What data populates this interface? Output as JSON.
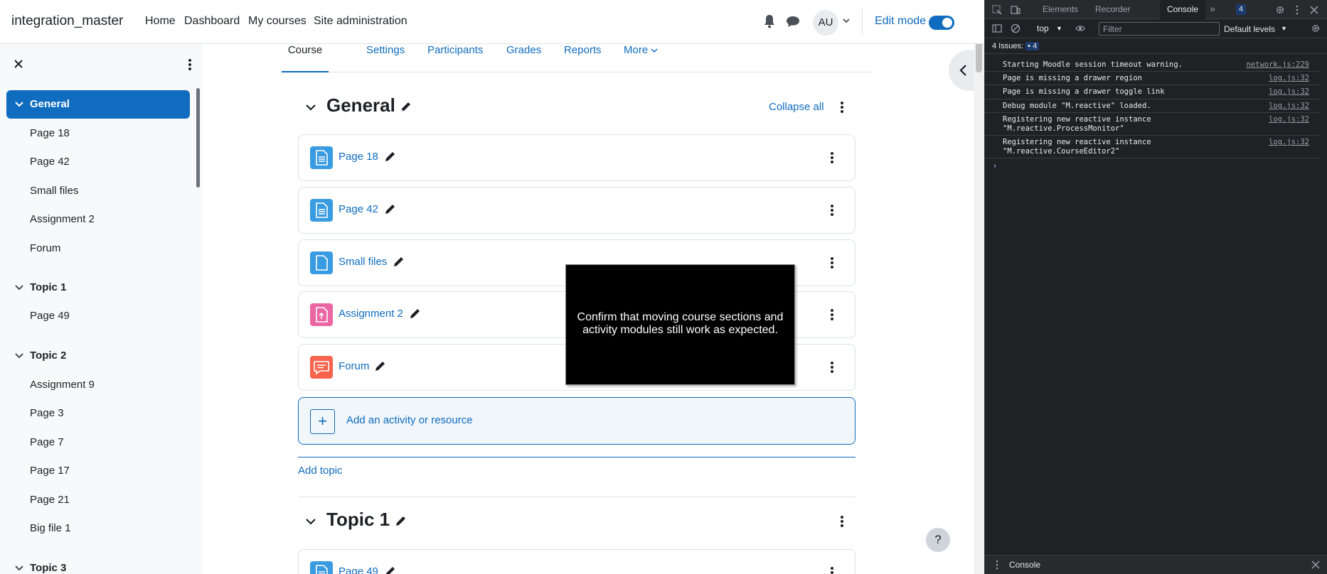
{
  "navbar": {
    "site_name": "integration_master",
    "links": [
      "Home",
      "Dashboard",
      "My courses",
      "Site administration"
    ],
    "avatar_initials": "AU",
    "edit_mode_label": "Edit mode",
    "edit_mode_on": true
  },
  "course_index": {
    "items": [
      {
        "label": "General",
        "type": "section",
        "active": true
      },
      {
        "label": "Page 18",
        "type": "activity"
      },
      {
        "label": "Page 42",
        "type": "activity"
      },
      {
        "label": "Small files",
        "type": "activity"
      },
      {
        "label": "Assignment 2",
        "type": "activity"
      },
      {
        "label": "Forum",
        "type": "activity"
      },
      {
        "label": "Topic 1",
        "type": "section"
      },
      {
        "label": "Page 49",
        "type": "activity"
      },
      {
        "label": "Topic 2",
        "type": "section"
      },
      {
        "label": "Assignment 9",
        "type": "activity"
      },
      {
        "label": "Page 3",
        "type": "activity"
      },
      {
        "label": "Page 7",
        "type": "activity"
      },
      {
        "label": "Page 17",
        "type": "activity"
      },
      {
        "label": "Page 21",
        "type": "activity"
      },
      {
        "label": "Big file 1",
        "type": "activity"
      },
      {
        "label": "Topic 3",
        "type": "section"
      }
    ]
  },
  "course_tabs": [
    "Course",
    "Settings",
    "Participants",
    "Grades",
    "Reports",
    "More"
  ],
  "sections": [
    {
      "title": "General",
      "collapse_all_label": "Collapse all",
      "activities": [
        {
          "name": "Page 18",
          "icon": "page-icon"
        },
        {
          "name": "Page 42",
          "icon": "page-icon"
        },
        {
          "name": "Small files",
          "icon": "file-icon"
        },
        {
          "name": "Assignment 2",
          "icon": "assignment-icon"
        },
        {
          "name": "Forum",
          "icon": "forum-icon"
        }
      ],
      "add_activity_label": "Add an activity or resource",
      "add_topic_label": "Add topic"
    },
    {
      "title": "Topic 1",
      "activities": [
        {
          "name": "Page 49",
          "icon": "page-icon"
        }
      ]
    }
  ],
  "tooltip_text": "Confirm that moving course sections and activity modules still work as expected.",
  "help_label": "?",
  "colors": {
    "brand": "#0f6cbf",
    "page_icon": "#399be2",
    "assignment_icon": "#eb66a2",
    "forum_icon": "#f7634d"
  },
  "devtools": {
    "tabs": [
      "Elements",
      "Recorder",
      "Console"
    ],
    "active_tab": "Console",
    "issues_badge": "4",
    "context": "top",
    "filter_placeholder": "Filter",
    "levels_label": "Default levels",
    "issues_label": "4 Issues:",
    "issues_count": "4",
    "messages": [
      {
        "text": "Starting Moodle session timeout warning.",
        "source": "network.js:229"
      },
      {
        "text": "Page is missing a drawer region",
        "source": "log.js:32"
      },
      {
        "text": "Page is missing a drawer toggle link",
        "source": "log.js:32"
      },
      {
        "text": "Debug module \"M.reactive\" loaded.",
        "source": "log.js:32"
      },
      {
        "text": "Registering new reactive instance\n\"M.reactive.ProcessMonitor\"",
        "source": "log.js:32"
      },
      {
        "text": "Registering new reactive instance\n\"M.reactive.CourseEditor2\"",
        "source": "log.js:32"
      }
    ],
    "drawer_tab": "Console"
  }
}
